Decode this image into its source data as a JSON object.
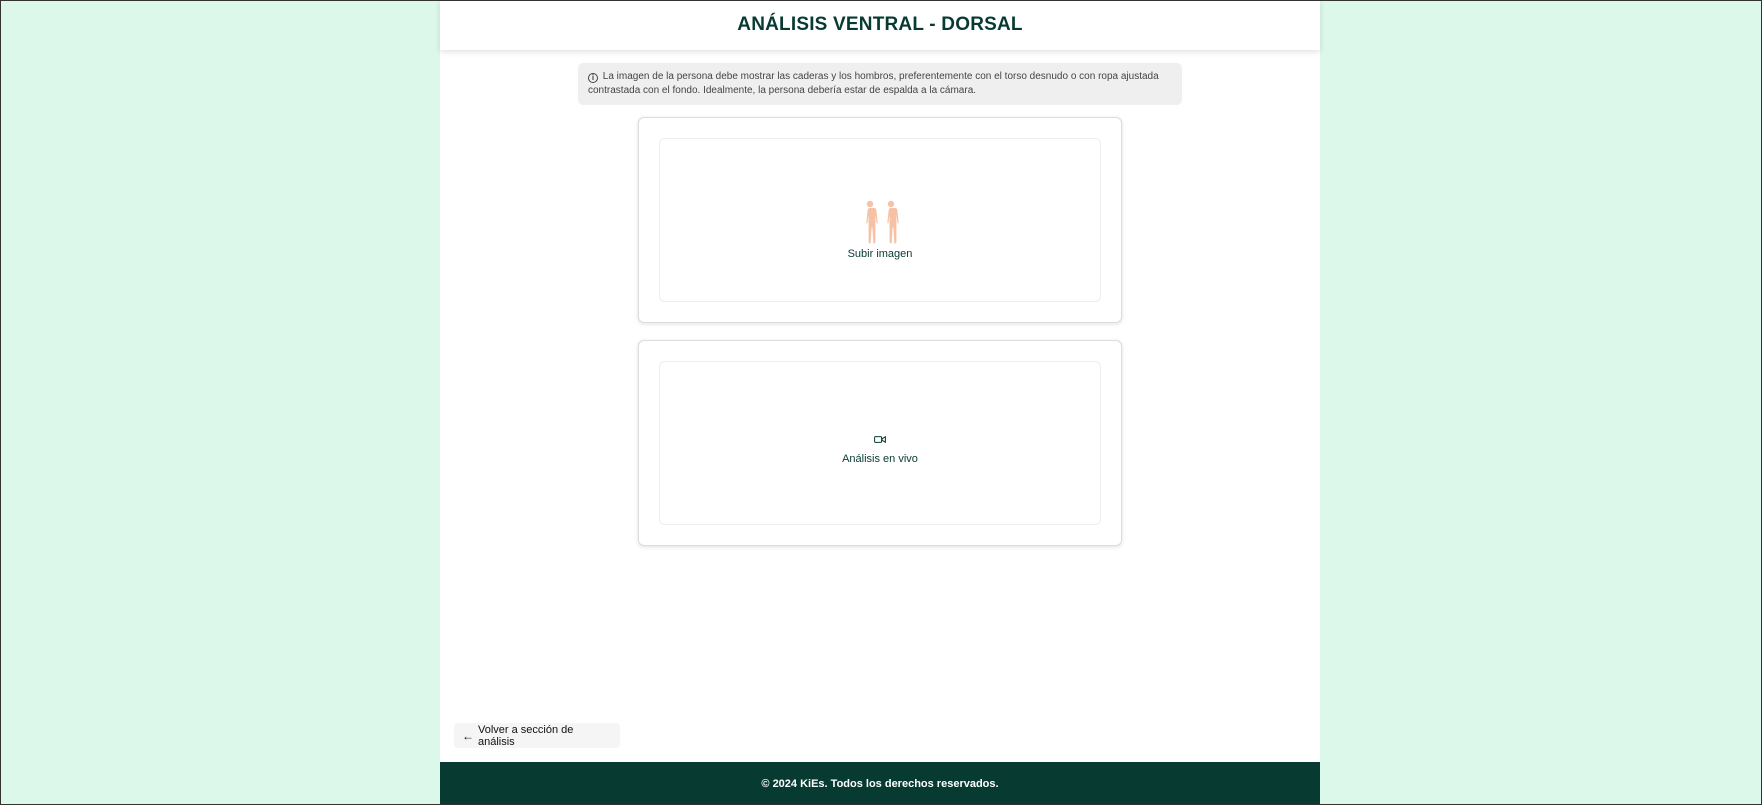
{
  "header": {
    "title": "ANÁLISIS VENTRAL - DORSAL"
  },
  "info": {
    "icon": "info-circle-icon",
    "text": "La imagen de la persona debe mostrar las caderas y los hombros, preferentemente con el torso desnudo o con ropa ajustada contrastada con el fondo. Idealmente, la persona debería estar de espalda a la cámara."
  },
  "upload": {
    "icon": "human-body-icon",
    "label": "Subir imagen"
  },
  "live": {
    "icon": "video-camera-icon",
    "label": "Análisis en vivo"
  },
  "back": {
    "icon": "arrow-left-icon",
    "label": "Volver a sección de análisis"
  },
  "footer": {
    "text": "© 2024 KiEs. Todos los derechos reservados."
  },
  "colors": {
    "page_background": "#dcf8ea",
    "brand_dark": "#073b32",
    "body_icon": "#f6c1a4"
  }
}
